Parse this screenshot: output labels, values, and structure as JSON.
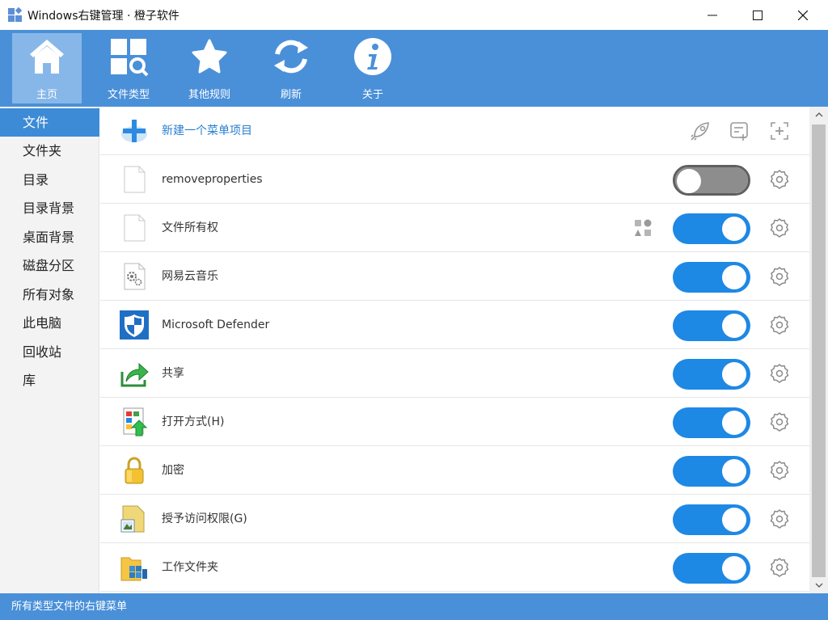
{
  "window": {
    "title": "Windows右键管理 · 橙子软件"
  },
  "toolbar": {
    "buttons": [
      {
        "label": "主页",
        "icon": "home-icon"
      },
      {
        "label": "文件类型",
        "icon": "file-type-search-icon"
      },
      {
        "label": "其他规则",
        "icon": "star-icon"
      },
      {
        "label": "刷新",
        "icon": "refresh-icon"
      },
      {
        "label": "关于",
        "icon": "info-icon"
      }
    ]
  },
  "sidebar": {
    "items": [
      {
        "label": "文件"
      },
      {
        "label": "文件夹"
      },
      {
        "label": "目录"
      },
      {
        "label": "目录背景"
      },
      {
        "label": "桌面背景"
      },
      {
        "label": "磁盘分区"
      },
      {
        "label": "所有对象"
      },
      {
        "label": "此电脑"
      },
      {
        "label": "回收站"
      },
      {
        "label": "库"
      }
    ]
  },
  "main": {
    "new_item_label": "新建一个菜单项目",
    "items": [
      {
        "label": "removeproperties",
        "enabled": false,
        "icon": "blank-file-icon"
      },
      {
        "label": "文件所有权",
        "enabled": true,
        "icon": "blank-file-icon",
        "extra_icon": "shapes-icon"
      },
      {
        "label": "网易云音乐",
        "enabled": true,
        "icon": "settings-file-icon"
      },
      {
        "label": "Microsoft Defender",
        "enabled": true,
        "icon": "defender-shield-icon"
      },
      {
        "label": "共享",
        "enabled": true,
        "icon": "share-arrow-icon"
      },
      {
        "label": "打开方式(H)",
        "enabled": true,
        "icon": "open-with-icon"
      },
      {
        "label": "加密",
        "enabled": true,
        "icon": "padlock-icon"
      },
      {
        "label": "授予访问权限(G)",
        "enabled": true,
        "icon": "grant-access-icon"
      },
      {
        "label": "工作文件夹",
        "enabled": true,
        "icon": "work-folder-icon"
      }
    ]
  },
  "status": {
    "text": "所有类型文件的右键菜单"
  },
  "colors": {
    "accent": "#4a90d9",
    "toggle_on": "#1e88e5",
    "sidebar_active": "#3d8bd6"
  }
}
